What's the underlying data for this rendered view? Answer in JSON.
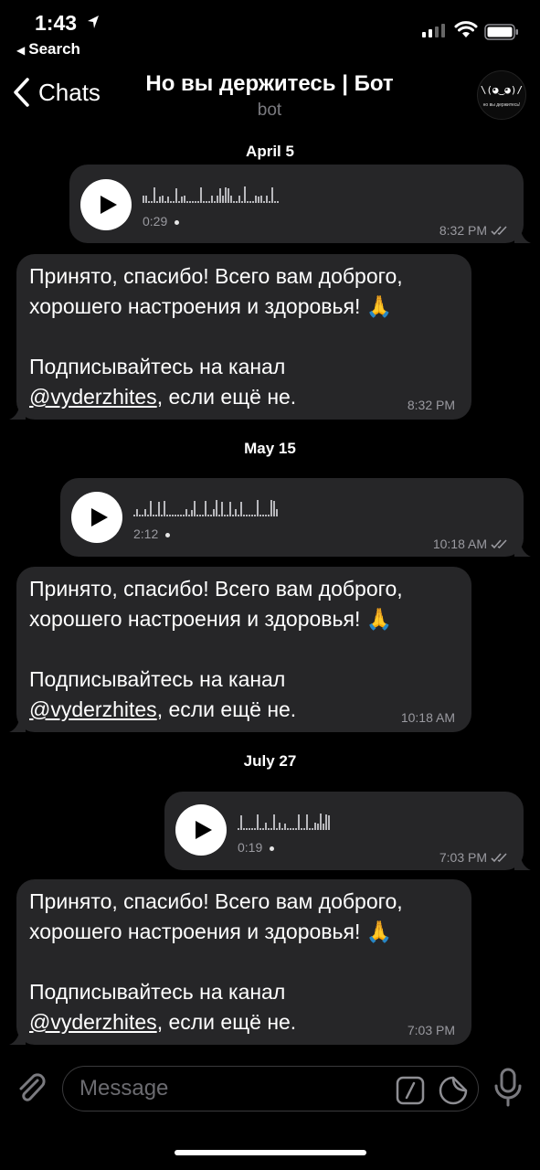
{
  "status_bar": {
    "time": "1:43",
    "back_app": "Search"
  },
  "header": {
    "back_label": "Chats",
    "title": "Но вы держитесь | Бот",
    "subtitle": "bot"
  },
  "messages": [
    {
      "date": "April 5",
      "voice": {
        "duration": "0:29",
        "time": "8:32 PM"
      },
      "reply": {
        "lines": [
          "Принято, спасибо! Всего вам доброго,",
          "хорошего настроения и здоровья! 🙏"
        ],
        "subscribe": "Подписывайтесь на канал",
        "link": "@vyderzhites",
        "suffix": ", если ещё не.",
        "time": "8:32 PM"
      }
    },
    {
      "date": "May 15",
      "voice": {
        "duration": "2:12",
        "time": "10:18 AM"
      },
      "reply": {
        "lines": [
          "Принято, спасибо! Всего вам доброго,",
          "хорошего настроения и здоровья! 🙏"
        ],
        "subscribe": "Подписывайтесь на канал",
        "link": "@vyderzhites",
        "suffix": ", если ещё не.",
        "time": "10:18 AM"
      }
    },
    {
      "date": "July 27",
      "voice": {
        "duration": "0:19",
        "time": "7:03 PM"
      },
      "reply": {
        "lines": [
          "Принято, спасибо! Всего вам доброго,",
          "хорошего настроения и здоровья! 🙏"
        ],
        "subscribe": "Подписывайтесь на канал",
        "link": "@vyderzhites",
        "suffix": ", если ещё не.",
        "time": "7:03 PM"
      }
    }
  ],
  "input": {
    "placeholder": "Message"
  },
  "icons": {
    "back": "chevron-left-icon",
    "attach": "paperclip-icon",
    "commands": "slash-command-icon",
    "sticker": "sticker-icon",
    "mic": "microphone-icon",
    "play": "play-icon",
    "read": "double-check-icon"
  },
  "colors": {
    "background": "#000000",
    "bubble": "#262628",
    "secondary_text": "#9a9aa0"
  }
}
